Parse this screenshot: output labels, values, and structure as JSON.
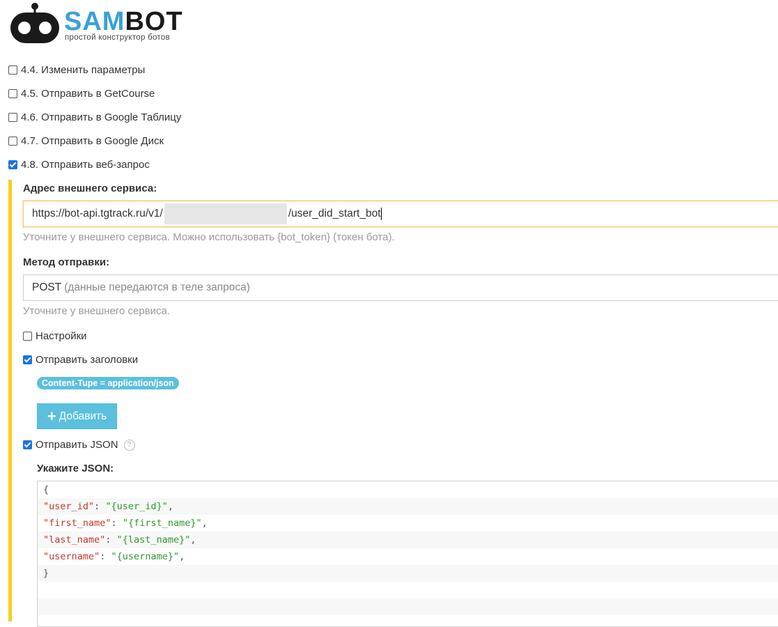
{
  "logo": {
    "brand_part1": "SAM",
    "brand_part2": "BOT",
    "tagline": "простой конструктор ботов"
  },
  "actions": [
    {
      "label": "4.4. Изменить параметры",
      "checked": false
    },
    {
      "label": "4.5. Отправить в GetCourse",
      "checked": false
    },
    {
      "label": "4.6. Отправить в Google Таблицу",
      "checked": false
    },
    {
      "label": "4.7. Отправить в Google Диск",
      "checked": false
    },
    {
      "label": "4.8. Отправить веб-запрос",
      "checked": true
    }
  ],
  "webhook": {
    "url_label": "Адрес внешнего сервиса:",
    "url_prefix": "https://bot-api.tgtrack.ru/v1/",
    "url_suffix": "/user_did_start_bot",
    "url_help": "Уточните у внешнего сервиса. Можно использовать {bot_token} (токен бота).",
    "method_label": "Метод отправки:",
    "method_value": "POST",
    "method_hint": "(данные передаются в теле запроса)",
    "method_help": "Уточните у внешнего сервиса.",
    "settings_label": "Настройки",
    "settings_checked": false,
    "headers_label": "Отправить заголовки",
    "headers_checked": true,
    "header_tag": "Content-Tupe = application/json",
    "add_button_label": "Добавить",
    "json_checkbox_label": "Отправить JSON",
    "json_checked": true,
    "json_help_symbol": "?",
    "json_label": "Укажите JSON:",
    "json_lines": [
      {
        "open": "{"
      },
      {
        "key": "\"user_id\"",
        "value": "\"{user_id}\"",
        "sep": ": ",
        "end": ","
      },
      {
        "key": "\"first_name\"",
        "value": "\"{first_name}\"",
        "sep": ": ",
        "end": ","
      },
      {
        "key": "\"last_name\"",
        "value": "\"{last_name}\"",
        "sep": ": ",
        "end": ","
      },
      {
        "key": "\"username\"",
        "value": "\"{username}\"",
        "sep": ": ",
        "end": ","
      },
      {
        "close": "}"
      }
    ]
  },
  "colors": {
    "accent_bar": "#f4d01d",
    "info_button": "#5bc0de",
    "brand_blue": "#3aa0d8",
    "checkbox_checked": "#1a73e8"
  }
}
